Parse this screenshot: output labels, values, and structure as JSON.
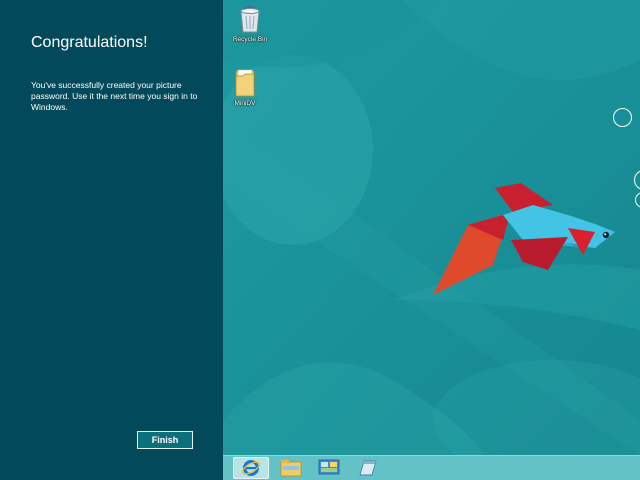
{
  "panel": {
    "title": "Congratulations!",
    "message": "You've successfully created your picture password. Use it the next time you sign in to Windows.",
    "finish_label": "Finish"
  },
  "desktop": {
    "icons": [
      {
        "label": "Recycle Bin",
        "icon": "recycle-bin-icon"
      },
      {
        "label": "MiniDV",
        "icon": "folder-icon"
      }
    ]
  },
  "taskbar": {
    "items": [
      {
        "name": "internet-explorer",
        "icon": "internet-explorer-icon",
        "active": true
      },
      {
        "name": "file-explorer",
        "icon": "file-explorer-icon",
        "active": false
      },
      {
        "name": "control-panel",
        "icon": "control-panel-icon",
        "active": false
      },
      {
        "name": "notepad",
        "icon": "notepad-icon",
        "active": false
      }
    ]
  },
  "colors": {
    "panel_bg": "#024a5b",
    "desktop_bg": "#1a8e96",
    "taskbar_bg": "#63c2c6",
    "fish_blue": "#44c4e4",
    "fish_red": "#c8202e",
    "fish_orange": "#e04a2c"
  }
}
